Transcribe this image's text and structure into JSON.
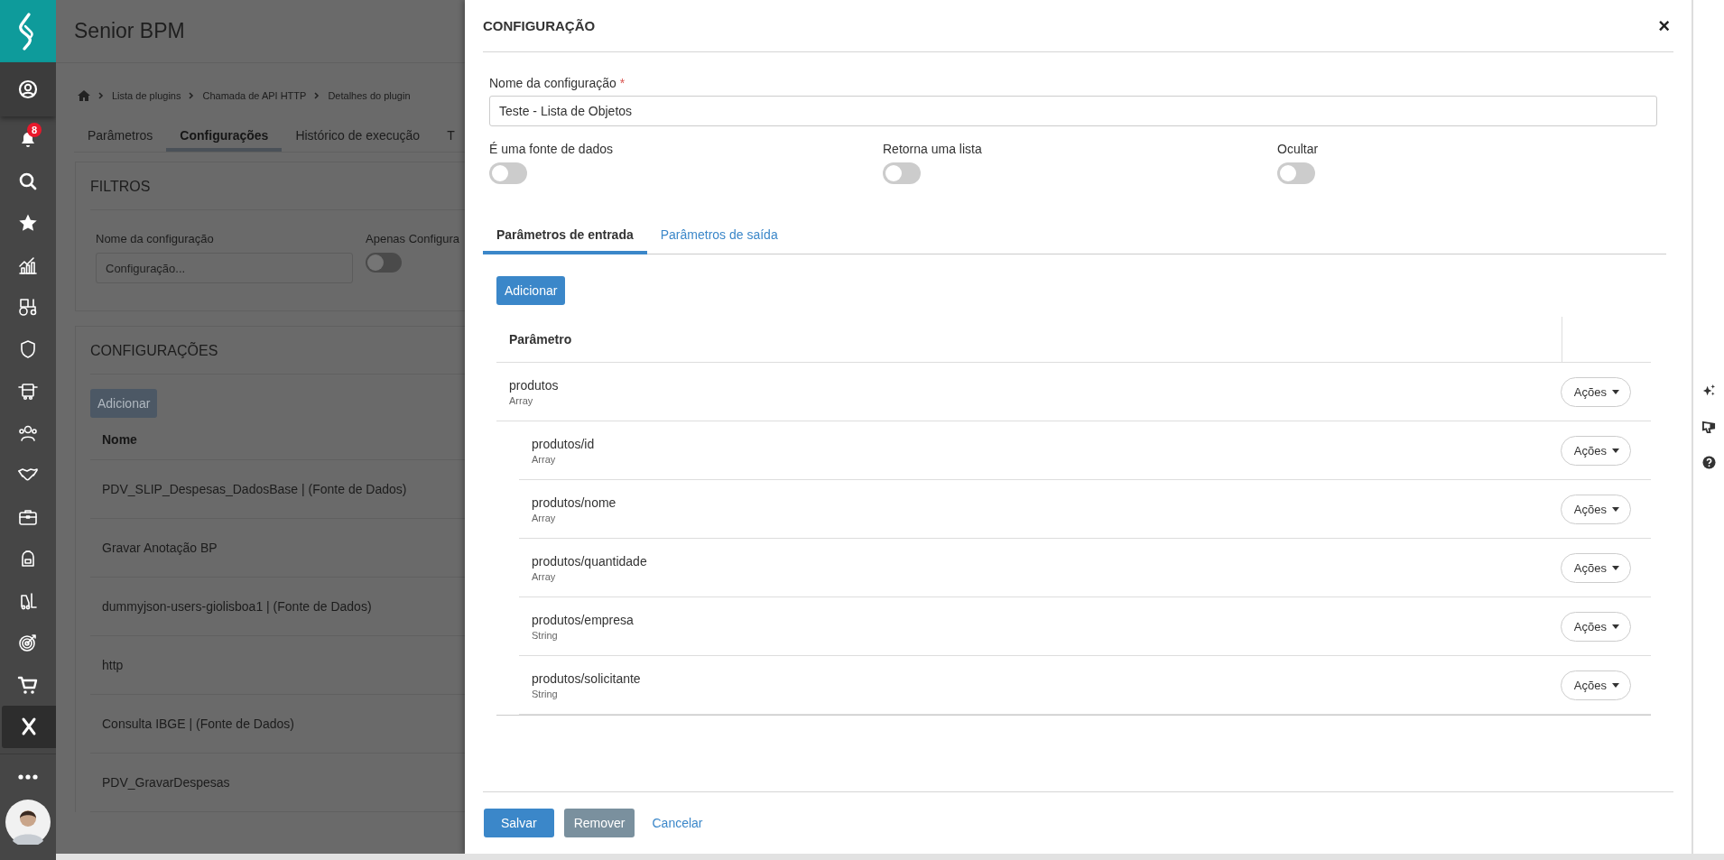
{
  "sidebar": {
    "items": [
      {
        "selected": false
      },
      {
        "selected": false,
        "badge": "8"
      },
      {
        "selected": false
      },
      {
        "selected": false
      },
      {
        "selected": false
      },
      {
        "selected": false
      },
      {
        "selected": false
      },
      {
        "selected": false
      },
      {
        "selected": false
      },
      {
        "selected": false
      },
      {
        "selected": false
      },
      {
        "selected": false
      },
      {
        "selected": false
      },
      {
        "selected": false
      },
      {
        "selected": false
      },
      {
        "selected": true
      }
    ]
  },
  "background_page": {
    "title": "Senior BPM",
    "breadcrumb": [
      "Lista de plugins",
      "Chamada de API HTTP",
      "Detalhes do plugin"
    ],
    "tabs": [
      {
        "label": "Parâmetros",
        "selected": false
      },
      {
        "label": "Configurações",
        "selected": true
      },
      {
        "label": "Histórico de execução",
        "selected": false
      },
      {
        "label": "T",
        "selected": false
      }
    ],
    "filters": {
      "title": "FILTROS",
      "name_label": "Nome da configuração",
      "name_placeholder": "Configuração...",
      "only_label": "Apenas Configura",
      "only_on": false
    },
    "list": {
      "title": "CONFIGURAÇÕES",
      "add_button": "Adicionar",
      "column": "Nome",
      "rows": [
        "PDV_SLIP_Despesas_DadosBase | (Fonte de Dados)",
        "Gravar Anotação BP",
        "dummyjson-users-giolisboa1 | (Fonte de Dados)",
        "http",
        "Consulta IBGE | (Fonte de Dados)",
        "PDV_GravarDespesas"
      ]
    }
  },
  "dialog": {
    "title": "CONFIGURAÇÃO",
    "close": "×",
    "name_label": "Nome da configuração",
    "required_mark": "*",
    "name_value": "Teste - Lista de Objetos",
    "toggles": [
      {
        "label": "É uma fonte de dados",
        "on": false
      },
      {
        "label": "Retorna uma lista",
        "on": false
      },
      {
        "label": "Ocultar",
        "on": false
      }
    ],
    "tabs": [
      {
        "label": "Parâmetros de entrada",
        "selected": true
      },
      {
        "label": "Parâmetros de saída",
        "selected": false
      }
    ],
    "add_button": "Adicionar",
    "table": {
      "columns": [
        "Parâmetro"
      ],
      "rows": [
        {
          "name": "produtos",
          "type": "Array",
          "action": "Ações",
          "children": [
            {
              "name": "produtos/id",
              "type": "Array",
              "action": "Ações"
            },
            {
              "name": "produtos/nome",
              "type": "Array",
              "action": "Ações"
            },
            {
              "name": "produtos/quantidade",
              "type": "Array",
              "action": "Ações"
            },
            {
              "name": "produtos/empresa",
              "type": "String",
              "action": "Ações"
            },
            {
              "name": "produtos/solicitante",
              "type": "String",
              "action": "Ações"
            }
          ]
        }
      ]
    },
    "footer": {
      "save": "Salvar",
      "remove": "Remover",
      "cancel": "Cancelar"
    }
  }
}
